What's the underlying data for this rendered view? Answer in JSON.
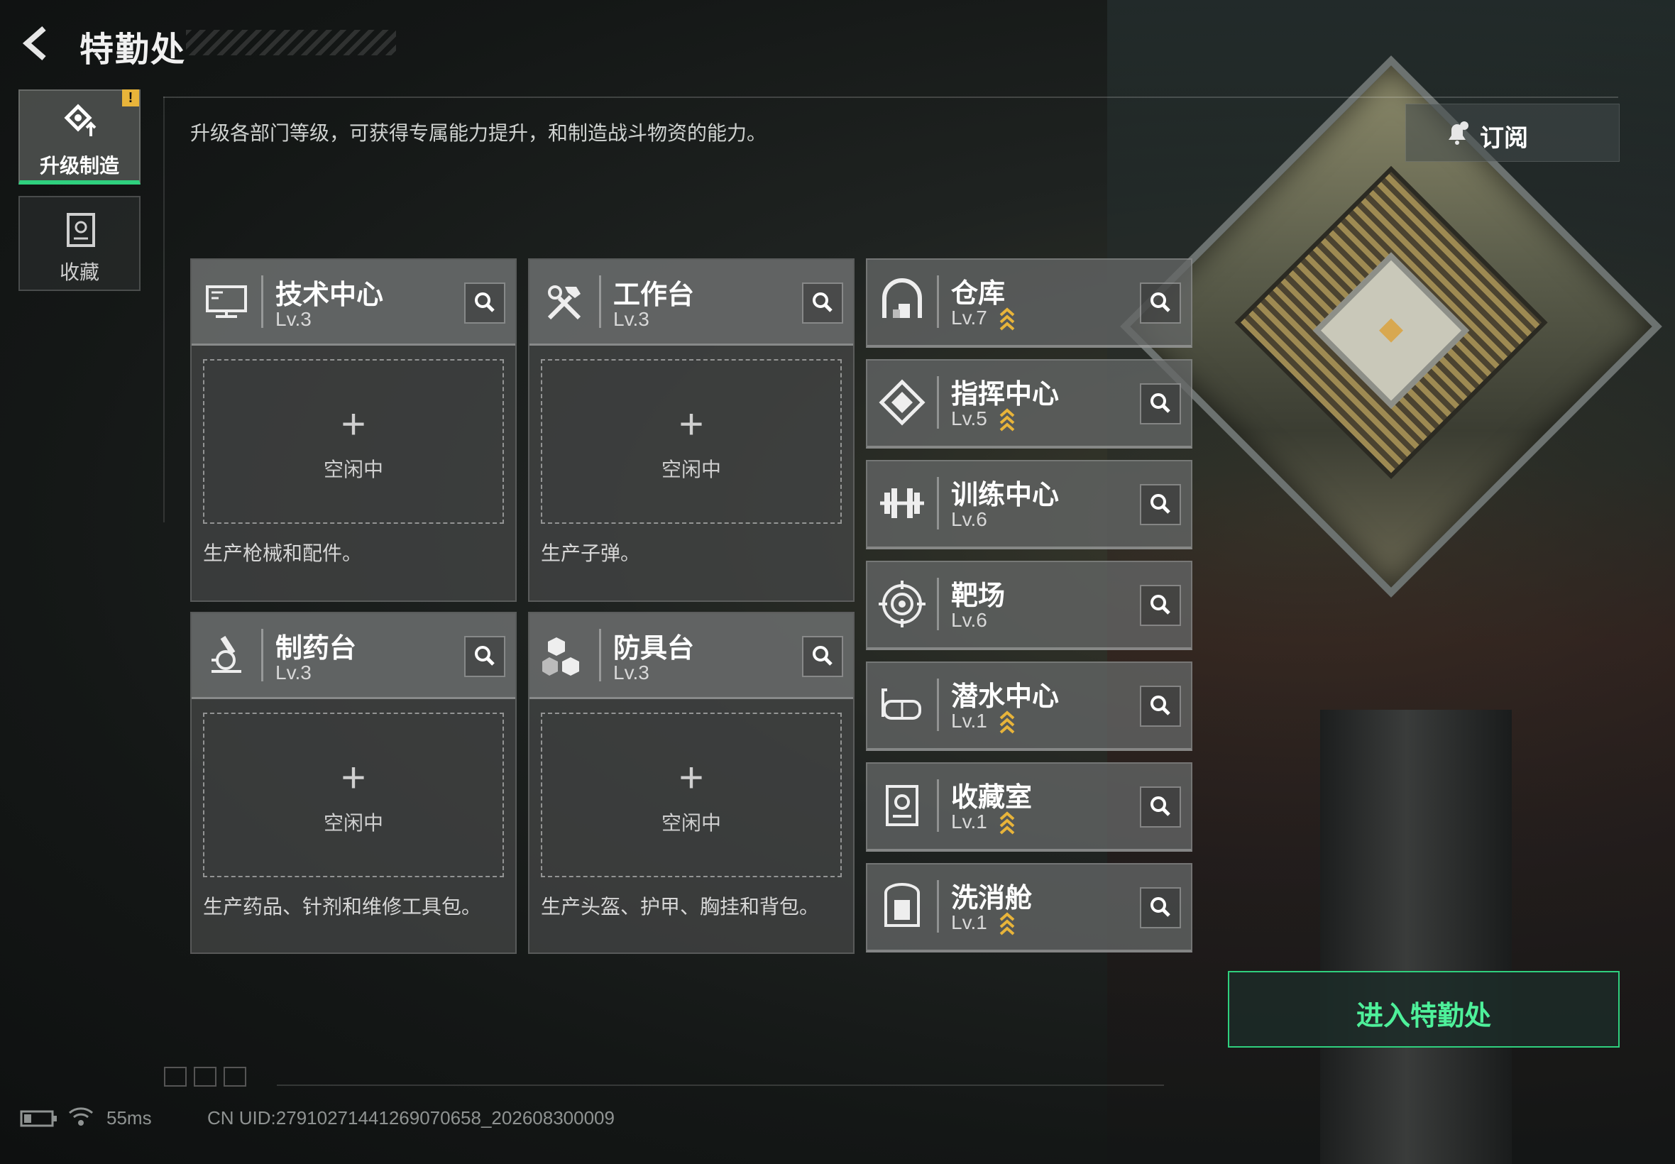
{
  "header": {
    "title": "特勤处"
  },
  "description": "升级各部门等级，可获得专属能力提升，和制造战斗物资的能力。",
  "side_tabs": [
    {
      "label": "升级制造",
      "badge": "!"
    },
    {
      "label": "收藏"
    }
  ],
  "subscribe": {
    "label": "订阅"
  },
  "facilities": [
    {
      "name": "技术中心",
      "level": "Lv.3",
      "slot_plus": "+",
      "slot_status": "空闲中",
      "desc": "生产枪械和配件。"
    },
    {
      "name": "工作台",
      "level": "Lv.3",
      "slot_plus": "+",
      "slot_status": "空闲中",
      "desc": "生产子弹。"
    },
    {
      "name": "制药台",
      "level": "Lv.3",
      "slot_plus": "+",
      "slot_status": "空闲中",
      "desc": "生产药品、针剂和维修工具包。"
    },
    {
      "name": "防具台",
      "level": "Lv.3",
      "slot_plus": "+",
      "slot_status": "空闲中",
      "desc": "生产头盔、护甲、胸挂和背包。"
    }
  ],
  "rooms": [
    {
      "name": "仓库",
      "level": "Lv.7",
      "upgradable": true
    },
    {
      "name": "指挥中心",
      "level": "Lv.5",
      "upgradable": true
    },
    {
      "name": "训练中心",
      "level": "Lv.6",
      "upgradable": false
    },
    {
      "name": "靶场",
      "level": "Lv.6",
      "upgradable": false
    },
    {
      "name": "潜水中心",
      "level": "Lv.1",
      "upgradable": true
    },
    {
      "name": "收藏室",
      "level": "Lv.1",
      "upgradable": true
    },
    {
      "name": "洗消舱",
      "level": "Lv.1",
      "upgradable": true
    }
  ],
  "enter_button": {
    "label": "进入特勤处"
  },
  "footer": {
    "ping": "55ms",
    "uid": "CN UID:2791027144126907065​8_202608300009"
  },
  "colors": {
    "accent_green": "#2fd07e",
    "upgrade_gold": "#e8b43a",
    "badge_yellow": "#e8b43a"
  }
}
